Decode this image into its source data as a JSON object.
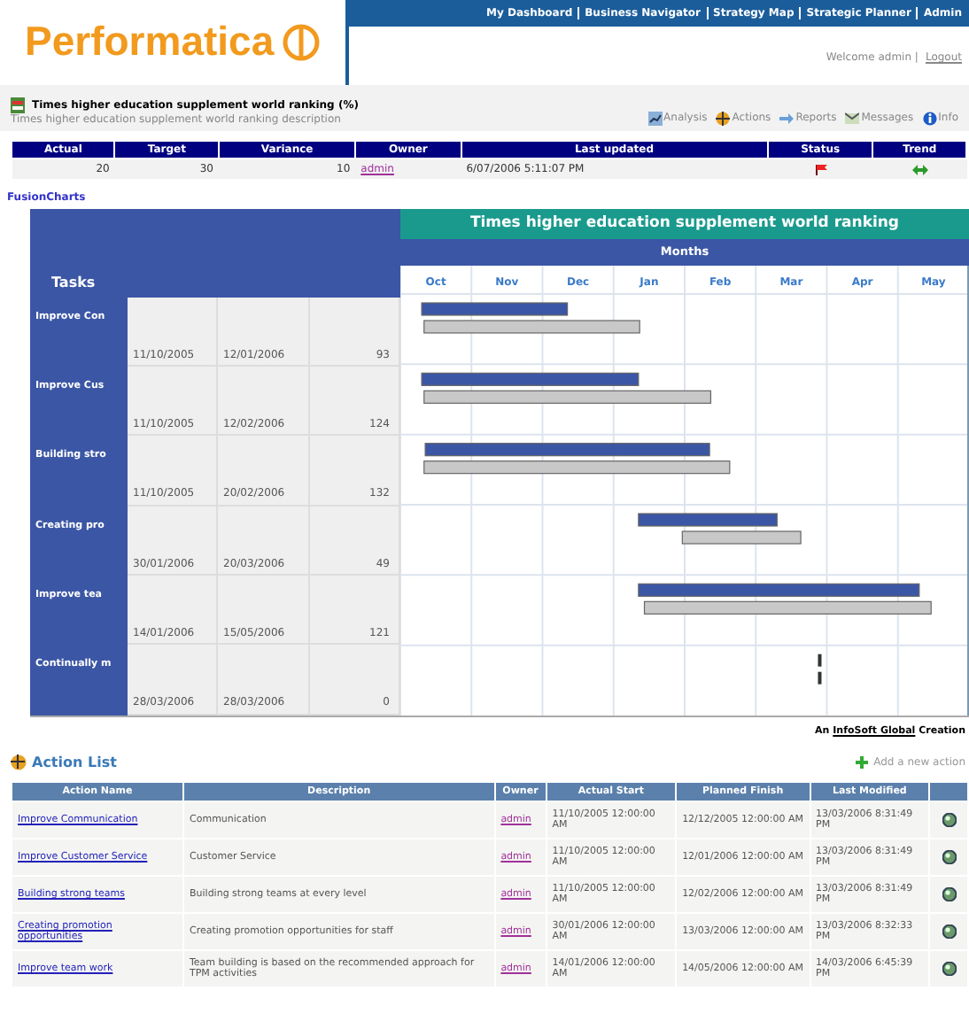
{
  "logo": {
    "text": "Performatica"
  },
  "nav": [
    "My Dashboard",
    "Business Navigator",
    "Strategy Map",
    "Strategic Planner",
    "Admin"
  ],
  "welcome": "Welcome admin |",
  "logout": "Logout",
  "measure": {
    "title": "Times higher education supplement world ranking (%)",
    "description": "Times higher education supplement world ranking description"
  },
  "toolbar": [
    "Analysis",
    "Actions",
    "Reports",
    "Messages",
    "Info"
  ],
  "summary": {
    "columns": [
      "Actual",
      "Target",
      "Variance",
      "Owner",
      "Last updated",
      "Status",
      "Trend"
    ],
    "row": {
      "actual": "20",
      "target": "30",
      "variance": "10",
      "owner": "admin",
      "last_updated": "6/07/2006 5:11:07 PM"
    }
  },
  "fusion_link": "FusionCharts",
  "gantt": {
    "tasks_label": "Tasks",
    "months_label": "Months",
    "tasks": [
      {
        "name": "Improve Con",
        "start": "11/10/2005",
        "end": "12/01/2006",
        "days": "93"
      },
      {
        "name": "Improve Cus",
        "start": "11/10/2005",
        "end": "12/02/2006",
        "days": "124"
      },
      {
        "name": "Building stro",
        "start": "11/10/2005",
        "end": "20/02/2006",
        "days": "132"
      },
      {
        "name": "Creating pro",
        "start": "30/01/2006",
        "end": "20/03/2006",
        "days": "49"
      },
      {
        "name": "Improve tea",
        "start": "14/01/2006",
        "end": "15/05/2006",
        "days": "121"
      },
      {
        "name": "Continually m",
        "start": "28/03/2006",
        "end": "28/03/2006",
        "days": "0"
      }
    ],
    "title": "Times higher education supplement world ranking",
    "months": [
      "Oct",
      "Nov",
      "Dec",
      "Jan",
      "Feb",
      "Mar",
      "Apr",
      "May"
    ]
  },
  "credit": {
    "prefix": "An",
    "link": "InfoSoft Global",
    "suffix": "Creation"
  },
  "actions": {
    "title": "Action List",
    "add": "Add a new action",
    "columns": [
      "Action Name",
      "Description",
      "Owner",
      "Actual Start",
      "Planned Finish",
      "Last Modified"
    ],
    "rows": [
      {
        "name": "Improve Communication",
        "description": "Communication",
        "owner": "admin",
        "start": "11/10/2005 12:00:00 AM",
        "finish": "12/12/2005 12:00:00 AM",
        "modified": "13/03/2006 8:31:49 PM"
      },
      {
        "name": "Improve Customer Service",
        "description": "Customer Service",
        "owner": "admin",
        "start": "11/10/2005 12:00:00 AM",
        "finish": "12/01/2006 12:00:00 AM",
        "modified": "13/03/2006 8:31:49 PM"
      },
      {
        "name": "Building strong teams",
        "description": "Building strong teams at every level",
        "owner": "admin",
        "start": "11/10/2005 12:00:00 AM",
        "finish": "12/02/2006 12:00:00 AM",
        "modified": "13/03/2006 8:31:49 PM"
      },
      {
        "name": "Creating promotion opportunities",
        "description": "Creating promotion opportunities for staff",
        "owner": "admin",
        "start": "30/01/2006 12:00:00 AM",
        "finish": "13/03/2006 12:00:00 AM",
        "modified": "13/03/2006 8:32:33 PM"
      },
      {
        "name": "Improve team work",
        "description": "Team building is based on the recommended approach for TPM activities",
        "owner": "admin",
        "start": "14/01/2006 12:00:00 AM",
        "finish": "14/05/2006 12:00:00 AM",
        "modified": "14/03/2006 6:45:39 PM"
      }
    ]
  }
}
